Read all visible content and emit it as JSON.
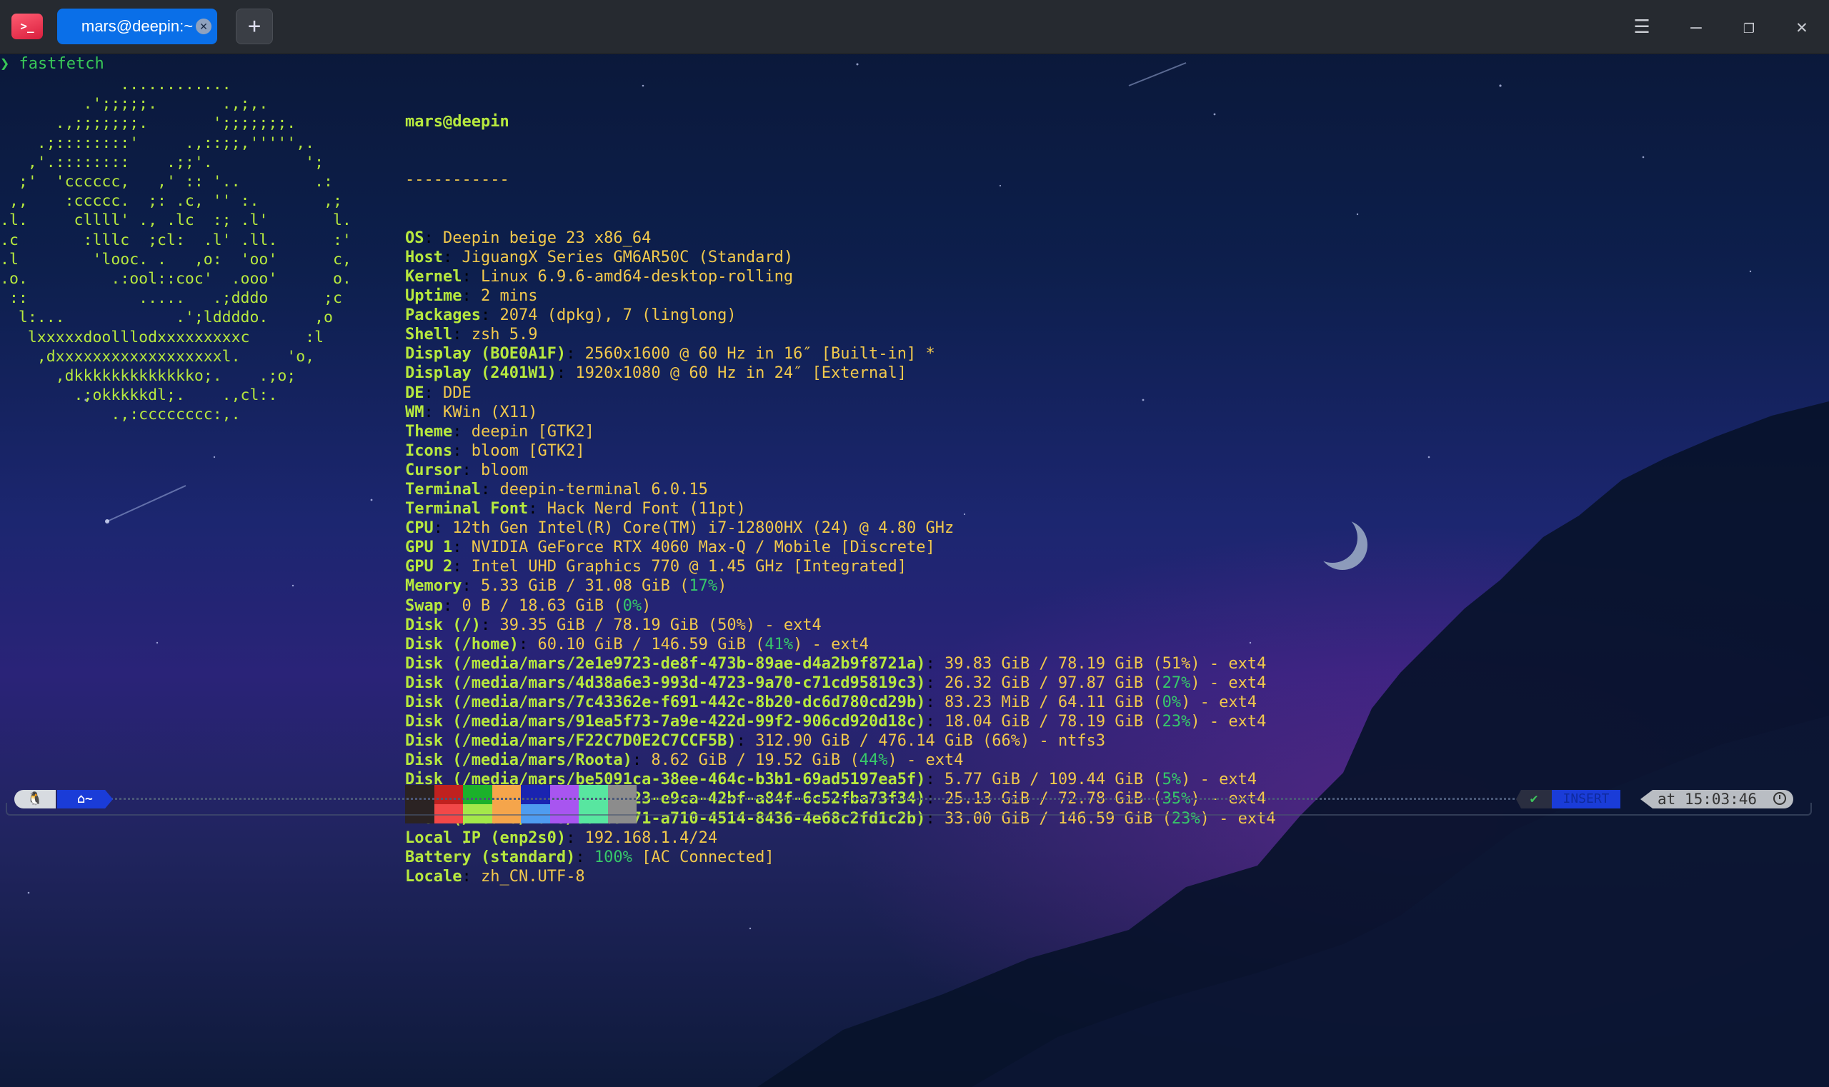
{
  "window": {
    "tab_title": "mars@deepin:~",
    "new_tab_label": "+",
    "menu_icon": "hamburger-icon",
    "minimize_icon": "minimize-icon",
    "restore_icon": "restore-icon",
    "close_icon": "close-icon"
  },
  "terminal": {
    "command": "❯ fastfetch",
    "logo_lines": [
      "             ............",
      "         .';;;;;.       .,;,.",
      "      .,;;;;;;;.       ';;;;;;;.",
      "    .;::::::::'     .,::;;,''''',.",
      "   ,'.::::::::    .;;'.          ';",
      "  ;'  'cccccc,   ,' :: '..        .:",
      " ,,    :ccccc.  ;: .c, '' :.       ,;",
      ".l.     cllll' ., .lc  :; .l'       l.",
      ".c       :lllc  ;cl:  .l' .ll.      :'",
      ".l        'looc. .   ,o:  'oo'      c,",
      ".o.         .:ool::coc'  .ooo'      o.",
      " ::            .....   .;dddo      ;c",
      "  l:...            .';lddddo.     ,o",
      "   lxxxxxdoolllodxxxxxxxxxc      :l",
      "    ,dxxxxxxxxxxxxxxxxxxl.     'o,",
      "      ,dkkkkkkkkkkkkko;.    .;o;",
      "        .;okkkkkdl;.    .,cl:.",
      "            .,:cccccccc:,."
    ],
    "user_host": "mars@deepin",
    "separator": "-----------",
    "info": [
      {
        "key": "OS",
        "value": "Deepin beige 23 x86_64"
      },
      {
        "key": "Host",
        "value": "JiguangX Series GM6AR50C (Standard)"
      },
      {
        "key": "Kernel",
        "value": "Linux 6.9.6-amd64-desktop-rolling"
      },
      {
        "key": "Uptime",
        "value": "2 mins"
      },
      {
        "key": "Packages",
        "value": "2074 (dpkg), 7 (linglong)"
      },
      {
        "key": "Shell",
        "value": "zsh 5.9"
      },
      {
        "key": "Display (BOE0A1F)",
        "value": "2560x1600 @ 60 Hz in 16″ [Built-in] *"
      },
      {
        "key": "Display (2401W1)",
        "value": "1920x1080 @ 60 Hz in 24″ [External]"
      },
      {
        "key": "DE",
        "value": "DDE"
      },
      {
        "key": "WM",
        "value": "KWin (X11)"
      },
      {
        "key": "Theme",
        "value": "deepin [GTK2]"
      },
      {
        "key": "Icons",
        "value": "bloom [GTK2]"
      },
      {
        "key": "Cursor",
        "value": "bloom"
      },
      {
        "key": "Terminal",
        "value": "deepin-terminal 6.0.15"
      },
      {
        "key": "Terminal Font",
        "value": "Hack Nerd Font (11pt)"
      },
      {
        "key": "CPU",
        "value": "12th Gen Intel(R) Core(TM) i7-12800HX (24) @ 4.80 GHz"
      },
      {
        "key": "GPU 1",
        "value": "NVIDIA GeForce RTX 4060 Max-Q / Mobile [Discrete]"
      },
      {
        "key": "GPU 2",
        "value": "Intel UHD Graphics 770 @ 1.45 GHz [Integrated]"
      },
      {
        "key": "Memory",
        "pre": "5.33 GiB / 31.08 GiB (",
        "pct": "17%",
        "post": ")"
      },
      {
        "key": "Swap",
        "pre": "0 B / 18.63 GiB (",
        "pct": "0%",
        "post": ")"
      },
      {
        "key": "Disk (/)",
        "pre": "39.35 GiB / 78.19 GiB (50%) - ext4"
      },
      {
        "key": "Disk (/home)",
        "pre": "60.10 GiB / 146.59 GiB (",
        "pct": "41%",
        "post": ") - ext4"
      },
      {
        "key": "Disk (/media/mars/2e1e9723-de8f-473b-89ae-d4a2b9f8721a)",
        "pre": "39.83 GiB / 78.19 GiB (51%) - ext4"
      },
      {
        "key": "Disk (/media/mars/4d38a6e3-993d-4723-9a70-c71cd95819c3)",
        "pre": "26.32 GiB / 97.87 GiB (",
        "pct": "27%",
        "post": ") - ext4"
      },
      {
        "key": "Disk (/media/mars/7c43362e-f691-442c-8b20-dc6d780cd29b)",
        "pre": "83.23 MiB / 64.11 GiB (",
        "pct": "0%",
        "post": ") - ext4"
      },
      {
        "key": "Disk (/media/mars/91ea5f73-7a9e-422d-99f2-906cd920d18c)",
        "pre": "18.04 GiB / 78.19 GiB (",
        "pct": "23%",
        "post": ") - ext4"
      },
      {
        "key": "Disk (/media/mars/F22C7D0E2C7CCF5B)",
        "pre": "312.90 GiB / 476.14 GiB (66%) - ntfs3"
      },
      {
        "key": "Disk (/media/mars/Roota)",
        "pre": "8.62 GiB / 19.52 GiB (",
        "pct": "44%",
        "post": ") - ext4"
      },
      {
        "key": "Disk (/media/mars/be5091ca-38ee-464c-b3b1-69ad5197ea5f)",
        "pre": "5.77 GiB / 109.44 GiB (",
        "pct": "5%",
        "post": ") - ext4"
      },
      {
        "key": "Disk (/media/mars/c15b3c23-e9ca-42bf-a84f-6c52fba73f34)",
        "pre": "25.13 GiB / 72.78 GiB (",
        "pct": "35%",
        "post": ") - ext4"
      },
      {
        "key": "Disk (/media/mars/e62b9471-a710-4514-8436-4e68c2fd1c2b)",
        "pre": "33.00 GiB / 146.59 GiB (",
        "pct": "23%",
        "post": ") - ext4"
      },
      {
        "key": "Local IP (enp2s0)",
        "value": "192.168.1.4/24"
      },
      {
        "key": "Battery (standard)",
        "pct": "100%",
        "post": " [AC Connected]"
      },
      {
        "key": "Locale",
        "value": "zh_CN.UTF-8"
      }
    ],
    "palette_top": [
      "#2b2323",
      "#c0211f",
      "#1bb12b",
      "#f5a54b",
      "#1a24b0",
      "#a855f0",
      "#58e6a0",
      "#8c8c8c"
    ],
    "palette_bottom": [
      "#2b2323",
      "#f24848",
      "#a4e84a",
      "#f5a54b",
      "#4f9cf0",
      "#a855f0",
      "#58e6a0",
      "#8c8c8c"
    ]
  },
  "prompt_line": {
    "os_icon": "linux-penguin-icon",
    "dir_icon": "home-icon",
    "dir_text": "~",
    "status_ok": "✔",
    "mode_text": "INSERT",
    "time_text": "at 15:03:46",
    "clock_icon": "clock-icon"
  }
}
